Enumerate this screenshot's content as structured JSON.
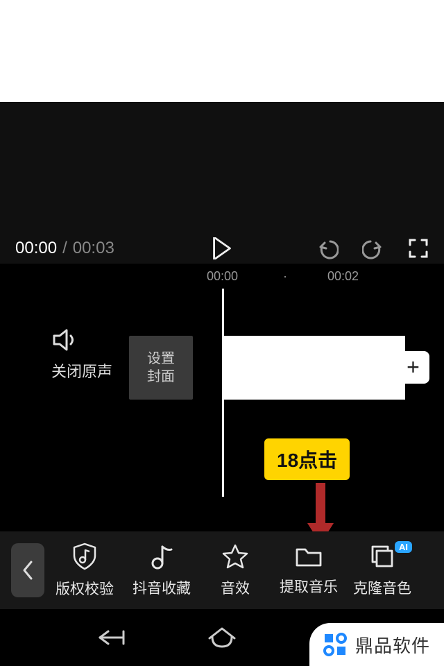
{
  "player": {
    "current_time": "00:00",
    "separator": "/",
    "total_time": "00:03"
  },
  "ruler": {
    "t1": "00:00",
    "dot": "·",
    "t2": "00:02"
  },
  "track": {
    "mute_label": "关闭原声",
    "cover_label": "设置\n封面",
    "add_label": "+"
  },
  "callout": {
    "text": "18点击"
  },
  "toolbar": {
    "items": [
      {
        "label": "版权校验",
        "icon": "shield-music"
      },
      {
        "label": "抖音收藏",
        "icon": "douyin-note"
      },
      {
        "label": "音效",
        "icon": "star"
      },
      {
        "label": "提取音乐",
        "icon": "folder"
      },
      {
        "label": "克隆音色",
        "icon": "clone",
        "ai": "AI"
      }
    ]
  },
  "watermark": {
    "text": "鼎品软件"
  }
}
